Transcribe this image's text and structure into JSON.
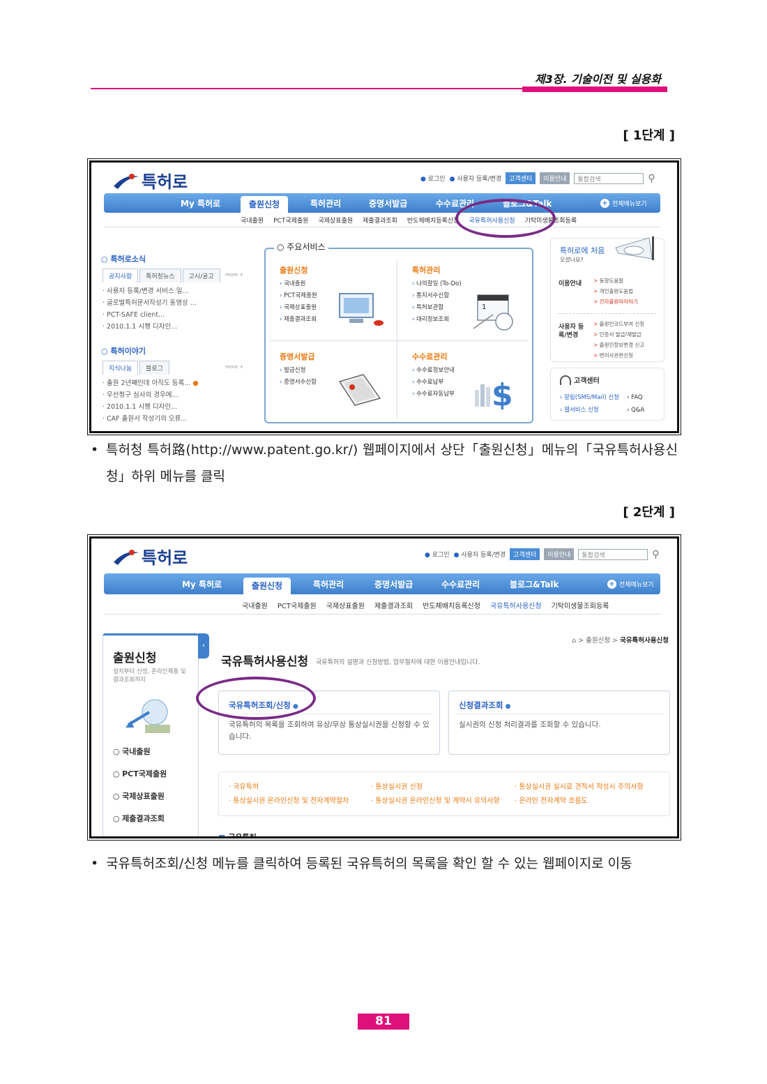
{
  "chapter_title": "제3장. 기술이전 및 실용화",
  "step1_label": "[ 1단계 ]",
  "step2_label": "[ 2단계 ]",
  "site": {
    "logo": "특허로",
    "top_links": [
      "로그인",
      "사용자 등록/변경"
    ],
    "badge_cs": "고객센터",
    "badge_guide": "이용안내",
    "search_placeholder": "통합검색",
    "nav": [
      "My 특허로",
      "출원신청",
      "특허관리",
      "증명서발급",
      "수수료관리",
      "블로그&Talk"
    ],
    "nav_all": "전체메뉴보기",
    "subnav": [
      "국내출원",
      "PCT국제출원",
      "국제상표출원",
      "제출결과조회",
      "반도체배치등록신청",
      "국유특허사용신청",
      "기탁미생물조회등록"
    ]
  },
  "shot1": {
    "news_title": "특허로소식",
    "news_tabs": [
      "공지사항",
      "특허청뉴스",
      "고시/공고"
    ],
    "more": "more +",
    "news_items": [
      "사용자 등록/변경 서비스 일...",
      "글로벌특허문서작성기 동영상 ...",
      "PCT-SAFE client...",
      "2010.1.1 시행 디자인..."
    ],
    "story_title": "특허이야기",
    "story_tabs": [
      "지식나눔",
      "블로그"
    ],
    "story_items": [
      "출원 2년째인데 아직도 등록...",
      "우선청구 심사의 경우에...",
      "2010.1.1 시행 디자인...",
      "CAF 출원서 작성기의 오류..."
    ],
    "main_services": "주요서비스",
    "svc_apply": "출원신청",
    "svc_apply_items": [
      "국내출원",
      "PCT국제출원",
      "국제상표출원",
      "제출결과조회"
    ],
    "svc_manage": "특허관리",
    "svc_manage_items": [
      "나의할일 (To-Do)",
      "통지서수신함",
      "특허보관함",
      "대리정보조회"
    ],
    "svc_cert": "증명서발급",
    "svc_cert_items": [
      "발급신청",
      "증명서수신함"
    ],
    "svc_fee": "수수료관리",
    "svc_fee_items": [
      "수수료정보안내",
      "수수료납부",
      "수수료자동납부"
    ],
    "first_visit": "특허로에 처음",
    "first_visit_sub": "오셨나요?",
    "guide_label": "이용안내",
    "guide_links": [
      "동향도움말",
      "개인출원도움법",
      "전자출원따라하기"
    ],
    "user_label": "사용자 등록/변경",
    "user_links": [
      "출원인코드부여 신청",
      "인증서 발급/재발급",
      "출원인정보변경 신고",
      "변리사관련신청"
    ],
    "cs_title": "고객센터",
    "cs_links": [
      "알림(SMS/Mail) 신청",
      "FAQ",
      "웹서비스 신청",
      "Q&A"
    ]
  },
  "shot2": {
    "side_title": "출원신청",
    "side_desc": "설치부터 신청, 온라인제출 및 결과조회까지",
    "side_menu": [
      "국내출원",
      "PCT국제출원",
      "국제상표출원",
      "제출결과조회"
    ],
    "crumb_mid": "출원신청",
    "crumb_last": "국유특허사용신청",
    "page_title": "국유특허사용신청",
    "page_desc": "국유특허의 설명과 신청방법, 업무절차에 대한 이용안내입니다.",
    "card1_title": "국유특허조회/신청",
    "card1_text": "국유특허의 목록을 조회하여 유상/무상 통상실시권을 신청할 수 있습니다.",
    "card2_title": "신청결과조회",
    "card2_text": "실시권의 신청 처리결과를 조회할 수 있습니다.",
    "links": [
      "국유특허",
      "통상실시권 신청",
      "통상실시권 실시료 견적서 작성시 주의사항",
      "통상실시권 온라인신청 및 전자계약절차",
      "통상실시권 온라인신청 및 계약시 유의사항",
      "온라인 전자계약 흐름도"
    ],
    "bottom_head": "국유특허"
  },
  "caption1": "특허청 특허路(http://www.patent.go.kr/) 웹페이지에서 상단「출원신청」메뉴의「국유특허사용신청」하위 메뉴를 클릭",
  "caption2": "국유특허조회/신청 메뉴를 클릭하여 등록된 국유특허의 목록을 확인 할 수 있는 웹페이지로 이동",
  "bullet": "•",
  "page_number": "81",
  "colors": {
    "accent_pink": "#e0107a",
    "nav_blue": "#3f7fcb",
    "highlight_purple": "#7a2b86",
    "orange": "#ec7a10"
  }
}
